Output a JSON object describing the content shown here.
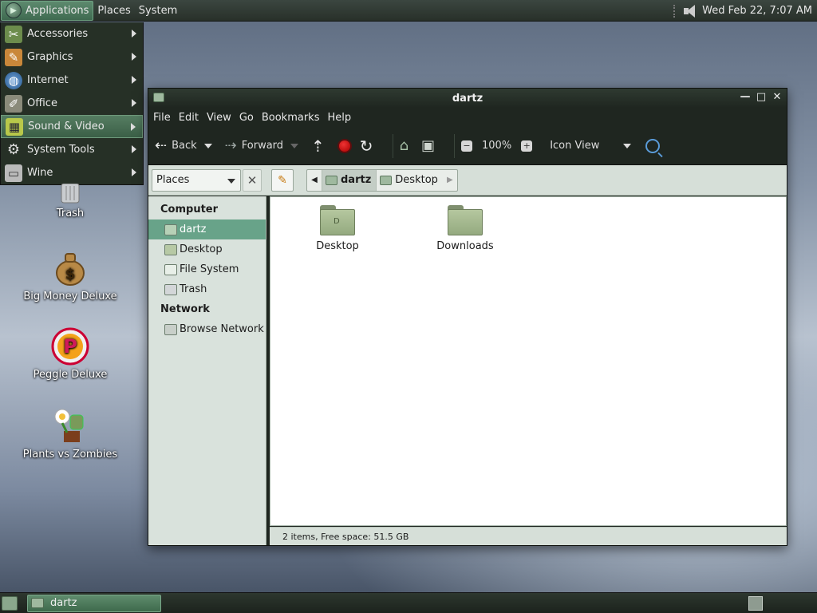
{
  "top_panel": {
    "applications": "Applications",
    "places": "Places",
    "system": "System",
    "clock": "Wed Feb 22,  7:07 AM",
    "volume_icon": "volume-icon"
  },
  "apps_menu": {
    "items": [
      {
        "label": "Accessories",
        "icon": "accessories-icon"
      },
      {
        "label": "Graphics",
        "icon": "graphics-icon"
      },
      {
        "label": "Internet",
        "icon": "internet-icon"
      },
      {
        "label": "Office",
        "icon": "office-icon"
      },
      {
        "label": "Sound & Video",
        "icon": "sound-video-icon"
      },
      {
        "label": "System Tools",
        "icon": "system-tools-icon"
      },
      {
        "label": "Wine",
        "icon": "wine-icon"
      }
    ],
    "highlighted": "Sound & Video"
  },
  "desktop": {
    "icons": [
      {
        "label": "Trash"
      },
      {
        "label": "Big Money Deluxe"
      },
      {
        "label": "Peggle Deluxe"
      },
      {
        "label": "Plants vs Zombies"
      }
    ]
  },
  "window": {
    "title": "dartz",
    "menu": [
      "File",
      "Edit",
      "View",
      "Go",
      "Bookmarks",
      "Help"
    ],
    "toolbar": {
      "back": "Back",
      "forward": "Forward",
      "zoom": "100%",
      "view_mode": "Icon View"
    },
    "location": {
      "side_pane": "Places",
      "breadcrumbs": [
        "dartz",
        "Desktop"
      ],
      "active_crumb": "dartz"
    },
    "sidebar": {
      "computer_header": "Computer",
      "computer_items": [
        "dartz",
        "Desktop",
        "File System",
        "Trash"
      ],
      "network_header": "Network",
      "network_items": [
        "Browse Network"
      ],
      "selected": "dartz"
    },
    "files": [
      {
        "name": "Desktop",
        "type": "folder"
      },
      {
        "name": "Downloads",
        "type": "folder"
      }
    ],
    "status": "2 items, Free space: 51.5 GB"
  },
  "taskbar": {
    "tasks": [
      "dartz"
    ]
  },
  "colors": {
    "panel": "#283029",
    "accent": "#68a389",
    "window_chrome": "#1f2620",
    "sidebar": "#d9e2dc"
  }
}
